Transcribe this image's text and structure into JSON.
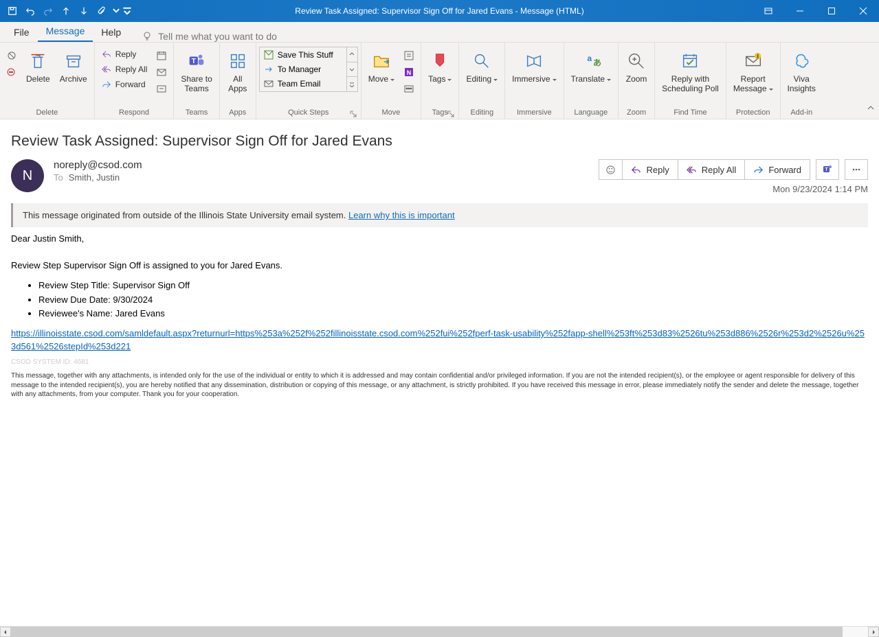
{
  "titlebar": {
    "title": "Review Task Assigned: Supervisor Sign Off for Jared Evans  -  Message (HTML)"
  },
  "menu": {
    "file": "File",
    "message": "Message",
    "help": "Help",
    "tellme": "Tell me what you want to do"
  },
  "ribbon": {
    "delete_group": "Delete",
    "delete": "Delete",
    "archive": "Archive",
    "respond_group": "Respond",
    "reply": "Reply",
    "reply_all": "Reply All",
    "forward": "Forward",
    "teams_group": "Teams",
    "share_teams": "Share to\nTeams",
    "apps_group": "Apps",
    "all_apps": "All\nApps",
    "qs_group": "Quick Steps",
    "qs_save": "Save This Stuff",
    "qs_mgr": "To Manager",
    "qs_team": "Team Email",
    "move_group": "Move",
    "move": "Move",
    "tags_group": "Tags",
    "tags": "Tags",
    "editing_group": "Editing",
    "editing": "Editing",
    "immersive_group": "Immersive",
    "immersive": "Immersive",
    "lang_group": "Language",
    "translate": "Translate",
    "zoom_group": "Zoom",
    "zoom": "Zoom",
    "findtime_group": "Find Time",
    "sched": "Reply with\nScheduling Poll",
    "protection_group": "Protection",
    "report": "Report\nMessage",
    "addin_group": "Add-in",
    "viva": "Viva\nInsights"
  },
  "message": {
    "subject": "Review Task Assigned: Supervisor Sign Off for Jared Evans",
    "avatar_initial": "N",
    "from": "noreply@csod.com",
    "to_label": "To",
    "to": "Smith, Justin",
    "timestamp": "Mon 9/23/2024 1:14 PM",
    "ext_banner_text": "This message originated from outside of the Illinois State University email system. ",
    "ext_banner_link": "Learn why this is important",
    "actions": {
      "reply": "Reply",
      "reply_all": "Reply All",
      "forward": "Forward"
    },
    "body": {
      "greeting": "Dear Justin Smith,",
      "line1": "Review Step Supervisor Sign Off is assigned to you for Jared Evans.",
      "b1": "Review Step Title: Supervisor Sign Off",
      "b2": "Review Due Date: 9/30/2024",
      "b3": "Reviewee's Name: Jared Evans",
      "link": "https://illinoisstate.csod.com/samldefault.aspx?returnurl=https%253a%252f%252fillinoisstate.csod.com%252fui%252fperf-task-usability%252fapp-shell%253ft%253d83%2526tu%253d886%2526r%253d2%2526u%253d561%2526stepId%253d221",
      "sysid": "CSOD SYSTEM ID: 4681",
      "disclaimer": "This message, together with any attachments, is intended only for the use of the individual or entity to which it is addressed and may contain confidential and/or privileged information. If you are not the intended recipient(s), or the employee or agent responsible for delivery of this message to the intended recipient(s), you are hereby notified that any dissemination, distribution or copying of this message, or any attachment, is strictly prohibited. If you have received this message in error, please immediately notify the sender and delete the message, together with any attachments, from your computer. Thank you for your cooperation."
    }
  }
}
